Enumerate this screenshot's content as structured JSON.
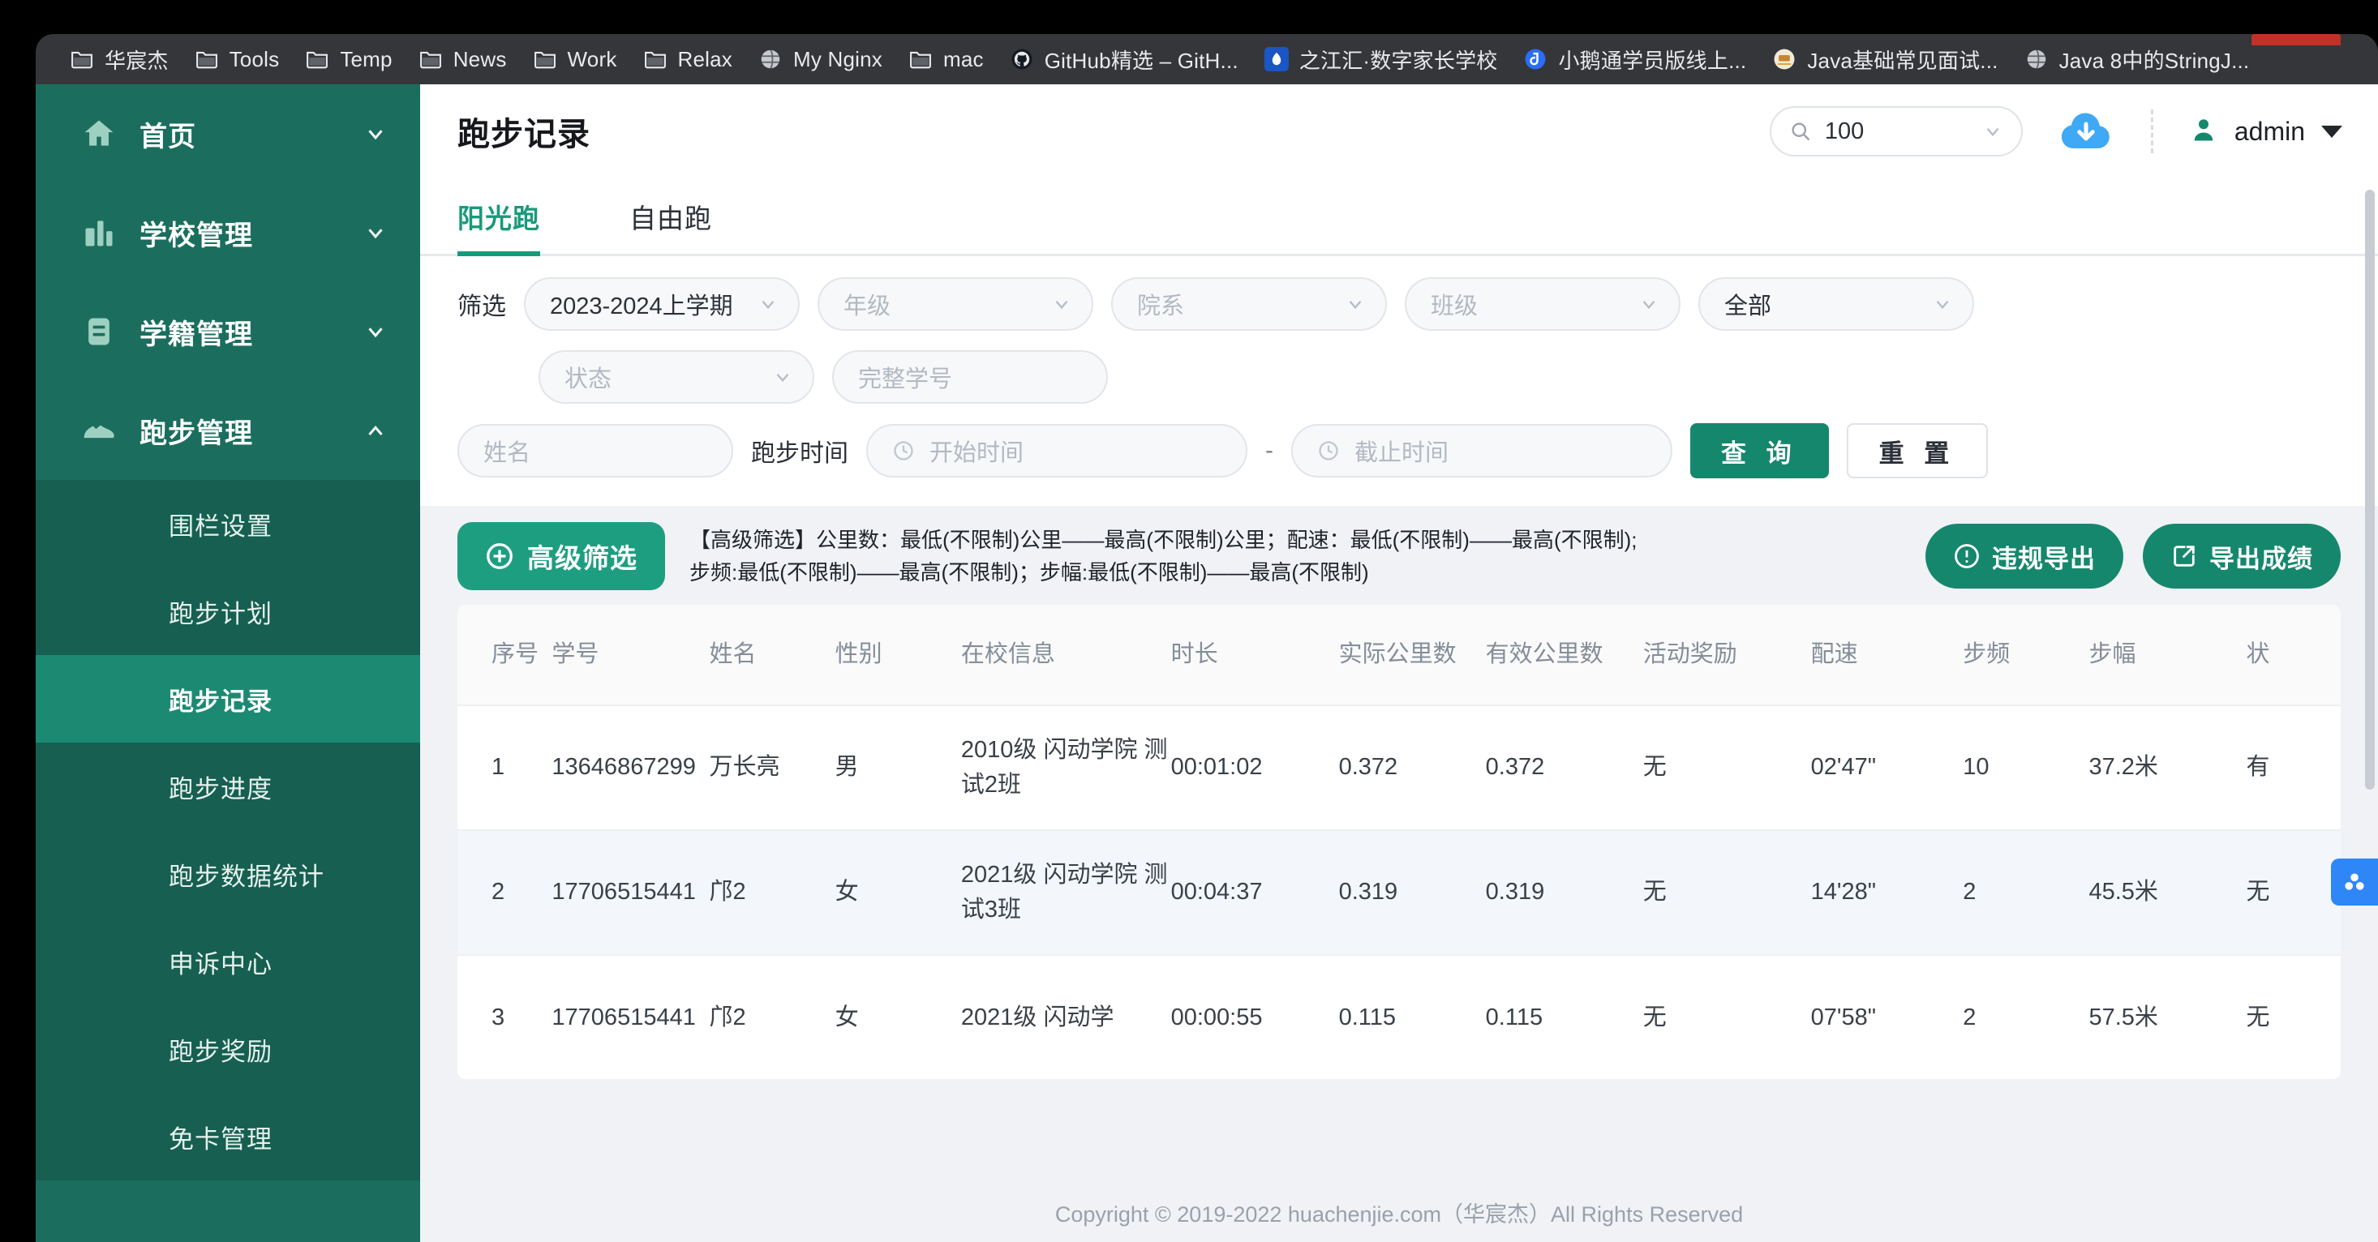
{
  "browser": {
    "bookmarks": [
      {
        "label": "华宸杰",
        "icon": "folder-icon"
      },
      {
        "label": "Tools",
        "icon": "folder-icon"
      },
      {
        "label": "Temp",
        "icon": "folder-icon"
      },
      {
        "label": "News",
        "icon": "folder-icon"
      },
      {
        "label": "Work",
        "icon": "folder-icon"
      },
      {
        "label": "Relax",
        "icon": "folder-icon"
      },
      {
        "label": "My Nginx",
        "icon": "globe-icon"
      },
      {
        "label": "mac",
        "icon": "folder-icon"
      },
      {
        "label": "GitHub精选 – GitH...",
        "icon": "github-icon"
      },
      {
        "label": "之江汇·数字家长学校",
        "icon": "zjh-icon"
      },
      {
        "label": "小鹅通学员版线上...",
        "icon": "xiaoetong-icon"
      },
      {
        "label": "Java基础常见面试...",
        "icon": "bell-icon"
      },
      {
        "label": "Java 8中的StringJ...",
        "icon": "globe-icon"
      }
    ]
  },
  "sidebar": {
    "groups": [
      {
        "label": "首页",
        "icon": "home-icon",
        "expanded": false
      },
      {
        "label": "学校管理",
        "icon": "building-icon",
        "expanded": false
      },
      {
        "label": "学籍管理",
        "icon": "document-icon",
        "expanded": false
      },
      {
        "label": "跑步管理",
        "icon": "shoe-icon",
        "expanded": true
      }
    ],
    "sub_items": [
      {
        "label": "围栏设置",
        "active": false
      },
      {
        "label": "跑步计划",
        "active": false
      },
      {
        "label": "跑步记录",
        "active": true
      },
      {
        "label": "跑步进度",
        "active": false
      },
      {
        "label": "跑步数据统计",
        "active": false
      },
      {
        "label": "申诉中心",
        "active": false
      },
      {
        "label": "跑步奖励",
        "active": false
      },
      {
        "label": "免卡管理",
        "active": false
      }
    ]
  },
  "header": {
    "title": "跑步记录",
    "search_value": "100",
    "search_icon": "search-icon",
    "download_icon": "cloud-download-icon",
    "user_icon": "user-icon",
    "username": "admin"
  },
  "tabs": [
    {
      "label": "阳光跑",
      "active": true
    },
    {
      "label": "自由跑",
      "active": false
    }
  ],
  "filters": {
    "label": "筛选",
    "row1": [
      {
        "name": "term",
        "value": "2023-2024上学期",
        "placeholder": "",
        "is_placeholder": false
      },
      {
        "name": "grade",
        "value": "年级",
        "placeholder": "年级",
        "is_placeholder": true
      },
      {
        "name": "department",
        "value": "院系",
        "placeholder": "院系",
        "is_placeholder": true
      },
      {
        "name": "class",
        "value": "班级",
        "placeholder": "班级",
        "is_placeholder": true
      },
      {
        "name": "all",
        "value": "全部",
        "placeholder": "",
        "is_placeholder": false
      }
    ],
    "row2": [
      {
        "name": "status",
        "value": "状态",
        "placeholder": "状态",
        "is_placeholder": true,
        "type": "select"
      },
      {
        "name": "student-id",
        "value": "完整学号",
        "placeholder": "完整学号",
        "is_placeholder": true,
        "type": "input"
      }
    ],
    "row3": {
      "name_placeholder": "姓名",
      "time_label": "跑步时间",
      "start_placeholder": "开始时间",
      "end_placeholder": "截止时间",
      "separator": "-",
      "query_button": "查 询",
      "reset_button": "重 置",
      "clock_icon": "clock-icon"
    }
  },
  "advanced": {
    "button_label": "高级筛选",
    "plus_icon": "plus-circle-icon",
    "description_line1": "【高级筛选】公里数：最低(不限制)公里——最高(不限制)公里；配速：最低(不限制)——最高(不限制);",
    "description_line2": "步频:最低(不限制)——最高(不限制)；步幅:最低(不限制)——最高(不限制)",
    "violation_export": "违规导出",
    "violation_icon": "exclamation-circle-icon",
    "score_export": "导出成绩",
    "score_icon": "export-icon"
  },
  "table": {
    "columns": [
      "序号",
      "学号",
      "姓名",
      "性别",
      "在校信息",
      "时长",
      "实际公里数",
      "有效公里数",
      "活动奖励",
      "配速",
      "步频",
      "步幅",
      "状"
    ],
    "rows": [
      {
        "序号": "1",
        "学号": "13646867299",
        "姓名": "万长亮",
        "性别": "男",
        "在校信息": "2010级 闪动学院 测试2班",
        "时长": "00:01:02",
        "实际公里数": "0.372",
        "有效公里数": "0.372",
        "活动奖励": "无",
        "配速": "02'47\"",
        "步频": "10",
        "步幅": "37.2米",
        "状": "有"
      },
      {
        "序号": "2",
        "学号": "17706515441",
        "姓名": "邝2",
        "性别": "女",
        "在校信息": "2021级 闪动学院 测试3班",
        "时长": "00:04:37",
        "实际公里数": "0.319",
        "有效公里数": "0.319",
        "活动奖励": "无",
        "配速": "14'28\"",
        "步频": "2",
        "步幅": "45.5米",
        "状": "无"
      },
      {
        "序号": "3",
        "学号": "17706515441",
        "姓名": "邝2",
        "性别": "女",
        "在校信息": "2021级 闪动学",
        "时长": "00:00:55",
        "实际公里数": "0.115",
        "有效公里数": "0.115",
        "活动奖励": "无",
        "配速": "07'58\"",
        "步频": "2",
        "步幅": "57.5米",
        "状": "无"
      }
    ]
  },
  "float_widget": {
    "icon": "cloud-sync-icon"
  },
  "footer": {
    "text": "Copyright © 2019-2022 huachenjie.com（华宸杰）All Rights Reserved"
  }
}
